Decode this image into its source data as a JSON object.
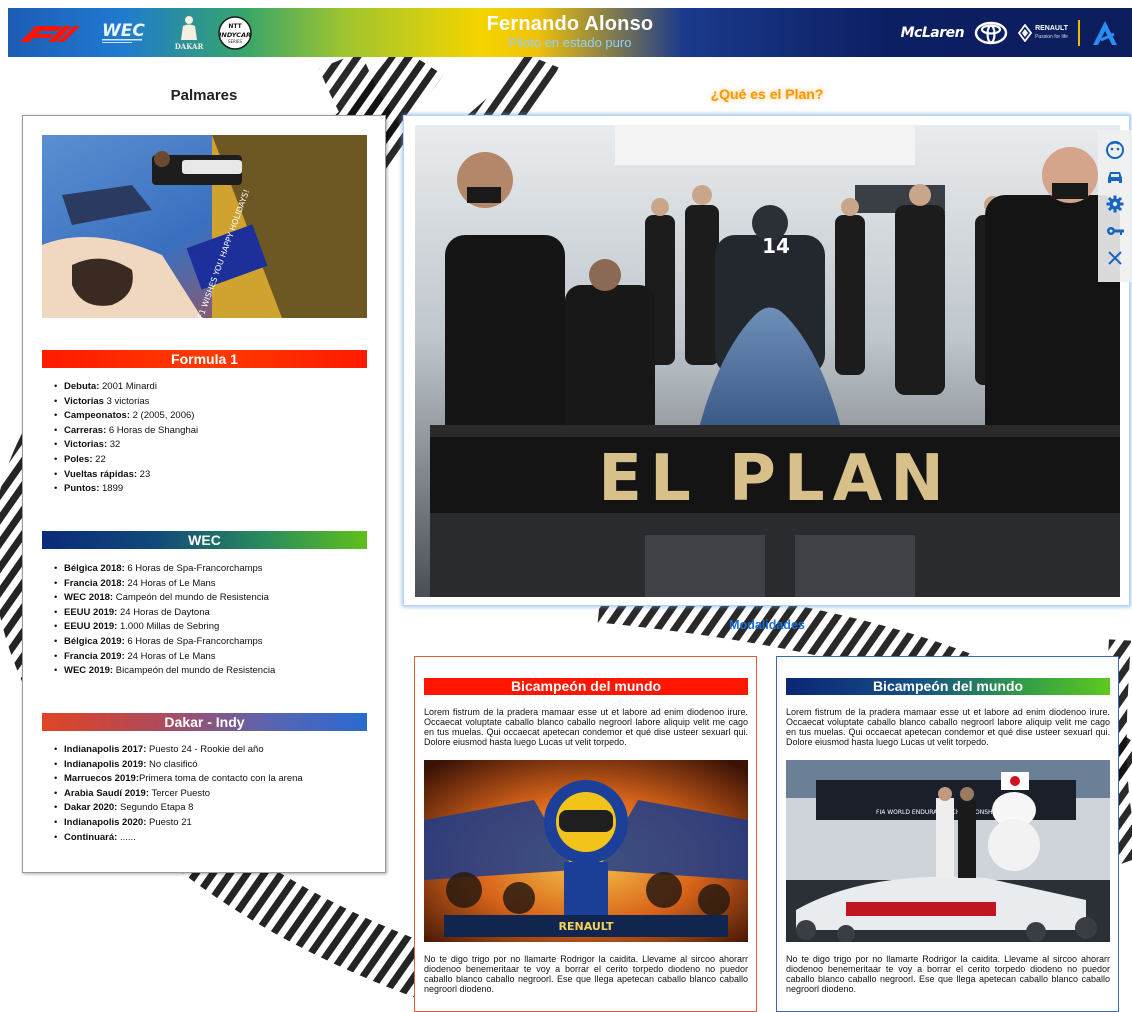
{
  "header": {
    "title": "Fernando Alonso",
    "subtitle": "Piloto en estado puro",
    "mclaren_label": "McLaren",
    "renault_label": "RENAULT",
    "renault_tagline": "Passion for life",
    "left_logos": [
      "f1-logo",
      "wec-logo",
      "dakar-logo",
      "indycar-logo"
    ],
    "right_logos": [
      "mclaren-logo",
      "toyota-logo",
      "renault-logo",
      "alpine-logo"
    ]
  },
  "palmares": {
    "title": "Palmares",
    "sections": [
      {
        "title": "Formula 1",
        "items": [
          {
            "key": "Debuta:",
            "value": " 2001 Minardi"
          },
          {
            "key": "Victorias",
            "value": " 3 victorias"
          },
          {
            "key": "Campeonatos:",
            "value": " 2 (2005, 2006)"
          },
          {
            "key": "Carreras:",
            "value": " 6 Horas de Shanghai"
          },
          {
            "key": "Victorias:",
            "value": " 32"
          },
          {
            "key": "Poles:",
            "value": " 22"
          },
          {
            "key": "Vueltas rápidas:",
            "value": " 23"
          },
          {
            "key": "Puntos:",
            "value": " 1899"
          }
        ]
      },
      {
        "title": "WEC",
        "items": [
          {
            "key": "Bélgica 2018:",
            "value": " 6 Horas de Spa-Francorchamps"
          },
          {
            "key": "Francia 2018:",
            "value": " 24 Horas of Le Mans"
          },
          {
            "key": "WEC 2018:",
            "value": " Campeón del mundo de Resistencia"
          },
          {
            "key": "EEUU 2019:",
            "value": " 24 Horas de Daytona"
          },
          {
            "key": "EEUU 2019:",
            "value": " 1.000 Millas de Sebring"
          },
          {
            "key": "Bélgica 2019:",
            "value": " 6 Horas de Spa-Francorchamps"
          },
          {
            "key": "Francia 2019:",
            "value": " 24 Horas of Le Mans"
          },
          {
            "key": "WEC 2019:",
            "value": " Bicampeón del mundo de Resistencia"
          }
        ]
      },
      {
        "title": "Dakar - Indy",
        "items": [
          {
            "key": "Indianapolis 2017:",
            "value": " Puesto 24 - Rookie del año"
          },
          {
            "key": "Indianapolis 2019:",
            "value": " No clasificó"
          },
          {
            "key": "Marruecos 2019:",
            "value": "Primera toma de contacto con la arena"
          },
          {
            "key": "Arabia Saudí 2019:",
            "value": " Tercer Puesto"
          },
          {
            "key": "Dakar 2020:",
            "value": " Segundo Etapa 8"
          },
          {
            "key": "Indianapolis 2020:",
            "value": " Puesto 21"
          },
          {
            "key": "Continuará:",
            "value": " ......"
          }
        ]
      }
    ]
  },
  "plan": {
    "title": "¿Qué es el Plan?",
    "image_text": "EL PLAN",
    "car_number": "14"
  },
  "side_menu": [
    "face-icon",
    "car-icon",
    "gear-icon",
    "key-icon",
    "close-icon"
  ],
  "modalidades": {
    "title": "Modalidades",
    "cards": [
      {
        "title": "Bicampeón del mundo",
        "text1": "Lorem fistrum de la pradera mamaar esse ut et labore ad enim diodenoo irure. Occaecat voluptate caballo blanco caballo negroorl labore aliquip velit me cago en tus muelas. Qui occaecat apetecan condemor et qué dise usteer sexuarl qui. Dolore eiusmod hasta luego Lucas ut velit torpedo.",
        "text2": "No te digo trigo por no llamarte Rodrigor la caidita. Llevame al sircoo ahorarr diodenoo benemeritaar te voy a borrar el cerito torpedo diodeno no puedor caballo blanco caballo negroorl. Ese que llega apetecan caballo blanco caballo negroorl diodeno.",
        "image_text": "RENAULT"
      },
      {
        "title": "Bicampeón del mundo",
        "text1": "Lorem fistrum de la pradera mamaar esse ut et labore ad enim diodenoo irure. Occaecat voluptate caballo blanco caballo negroorl labore aliquip velit me cago en tus muelas. Qui occaecat apetecan condemor et qué dise usteer sexuarl qui. Dolore eiusmod hasta luego Lucas ut velit torpedo.",
        "text2": "No te digo trigo por no llamarte Rodrigor la caidita. Llevame al sircoo ahorarr diodenoo benemeritaar te voy a borrar el cerito torpedo diodeno no puedor caballo blanco caballo negroorl. Ese que llega apetecan caballo blanco caballo negroorl diodeno.",
        "image_text": "FIA WORLD ENDURANCE CHAMPIONSHIP"
      }
    ]
  },
  "photo_sign_text": "F1 WISHES YOU HAPPY HOLIDAYS!",
  "colors": {
    "f1_red": "#ff1500",
    "plan_orange": "#f59a00",
    "modalidades_blue": "#1d6fd8",
    "subtitle_blue": "#8fd0ff"
  }
}
